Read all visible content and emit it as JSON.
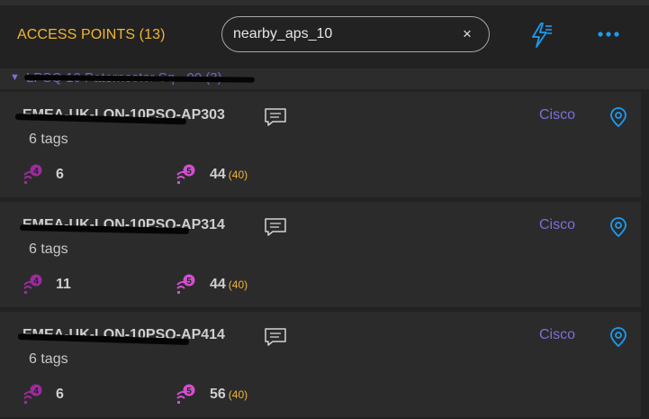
{
  "header": {
    "title": "ACCESS POINTS (13)",
    "search_value": "nearby_aps_10",
    "clear_label": "×",
    "accent": "#f2b632",
    "icon_accent": "#1e9bf0"
  },
  "group": {
    "label": "LPSQ 10 Paternoster Sq - 00 (3)",
    "color": "#6f68c9"
  },
  "cards": [
    {
      "name": "EMEA-UK-LON-10PSQ-AP303",
      "tags": "6 tags",
      "vendor": "Cisco",
      "band4_count": "6",
      "band5_count": "44",
      "band5_sub": "(40)"
    },
    {
      "name": "EMEA-UK-LON-10PSQ-AP314",
      "tags": "6 tags",
      "vendor": "Cisco",
      "band4_count": "11",
      "band5_count": "44",
      "band5_sub": "(40)"
    },
    {
      "name": "EMEA-UK-LON-10PSQ-AP414",
      "tags": "6 tags",
      "vendor": "Cisco",
      "band4_count": "6",
      "band5_count": "56",
      "band5_sub": "(40)"
    }
  ],
  "icons": {
    "flash": "flash-settings-icon",
    "more": "more-options-icon",
    "comment": "comment-icon",
    "pin": "location-pin-icon",
    "band4": "wifi-4-badge-icon",
    "band5": "wifi-5-badge-icon"
  }
}
